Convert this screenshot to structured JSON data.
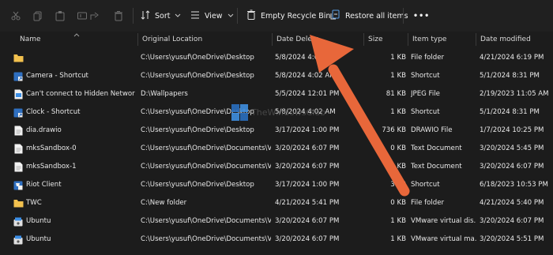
{
  "toolbar": {
    "sort_label": "Sort",
    "view_label": "View",
    "empty_bin_label": "Empty Recycle Bin",
    "restore_all_label": "Restore all items",
    "more_label": "•••"
  },
  "columns": {
    "name": "Name",
    "original_location": "Original Location",
    "date_deleted": "Date Delete",
    "size": "Size",
    "item_type": "Item type",
    "date_modified": "Date modified"
  },
  "rows": [
    {
      "icon": "folder-icon",
      "name": "",
      "location": "C:\\Users\\yusuf\\OneDrive\\Desktop",
      "deleted": "5/8/2024 4:02 AM",
      "size": "1 KB",
      "type": "File folder",
      "modified": "4/21/2024 6:19 PM"
    },
    {
      "icon": "shortcut-icon",
      "name": "Camera - Shortcut",
      "location": "C:\\Users\\yusuf\\OneDrive\\Desktop",
      "deleted": "5/8/2024 4:02 AM",
      "size": "1 KB",
      "type": "Shortcut",
      "modified": "5/1/2024 8:31 PM"
    },
    {
      "icon": "image-file-icon",
      "name": "Can't connect to Hidden Network",
      "location": "D:\\Wallpapers",
      "deleted": "5/5/2024 12:01 PM",
      "size": "81 KB",
      "type": "JPEG File",
      "modified": "2/19/2023 11:05 AM"
    },
    {
      "icon": "shortcut-icon",
      "name": "Clock - Shortcut",
      "location": "C:\\Users\\yusuf\\OneDrive\\Desktop",
      "deleted": "5/8/2024 4:02 AM",
      "size": "1 KB",
      "type": "Shortcut",
      "modified": "5/1/2024 8:31 PM"
    },
    {
      "icon": "document-icon",
      "name": "dia.drawio",
      "location": "C:\\Users\\yusuf\\OneDrive\\Desktop",
      "deleted": "3/17/2024 1:00 PM",
      "size": "736 KB",
      "type": "DRAWIO File",
      "modified": "1/7/2024 10:25 PM"
    },
    {
      "icon": "document-icon",
      "name": "mksSandbox-0",
      "location": "C:\\Users\\yusuf\\OneDrive\\Documents\\Virt...",
      "deleted": "3/20/2024 6:07 PM",
      "size": "0 KB",
      "type": "Text Document",
      "modified": "3/20/2024 5:45 PM"
    },
    {
      "icon": "document-icon",
      "name": "mksSandbox-1",
      "location": "C:\\Users\\yusuf\\OneDrive\\Documents\\Virt...",
      "deleted": "3/20/2024 6:07 PM",
      "size": "70 KB",
      "type": "Text Document",
      "modified": "3/20/2024 6:07 PM"
    },
    {
      "icon": "riot-client-icon",
      "name": "Riot Client",
      "location": "C:\\Users\\yusuf\\OneDrive\\Desktop",
      "deleted": "3/17/2024 1:00 PM",
      "size": "3 KB",
      "type": "Shortcut",
      "modified": "6/18/2023 10:53 PM"
    },
    {
      "icon": "folder-icon",
      "name": "TWC",
      "location": "C:\\New folder",
      "deleted": "4/21/2024 5:41 PM",
      "size": "0 KB",
      "type": "File folder",
      "modified": "4/21/2024 5:40 PM"
    },
    {
      "icon": "virtual-disk-icon",
      "name": "Ubuntu",
      "location": "C:\\Users\\yusuf\\OneDrive\\Documents\\Virt...",
      "deleted": "3/20/2024 6:07 PM",
      "size": "1 KB",
      "type": "VMware virtual dis...",
      "modified": "3/20/2024 6:07 PM"
    },
    {
      "icon": "virtual-disk-icon",
      "name": "Ubuntu",
      "location": "C:\\Users\\yusuf\\OneDrive\\Documents\\Virt...",
      "deleted": "3/20/2024 6:07 PM",
      "size": "1 KB",
      "type": "VMware virtual ma...",
      "modified": "3/20/2024 5:51 PM"
    }
  ],
  "watermark_text": "TheWindowsClub",
  "colors": {
    "background": "#1c1c1c",
    "toolbar": "#202020",
    "arrow": "#e8673a",
    "icon_blue": "#3b8ee6",
    "folder_yellow": "#f2c14e"
  }
}
